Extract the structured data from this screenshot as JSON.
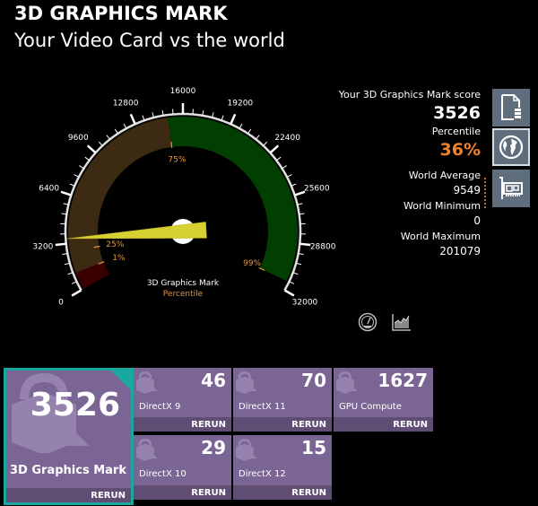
{
  "header": {
    "title": "3D GRAPHICS MARK",
    "subtitle": "Your Video Card vs the world"
  },
  "gauge": {
    "min": 0,
    "max": 32000,
    "value": 3526,
    "major_ticks": [
      "0",
      "3200",
      "6400",
      "9600",
      "12800",
      "16000",
      "19200",
      "22400",
      "25600",
      "28800",
      "32000"
    ],
    "bands": [
      {
        "name": "bottom-1-percent",
        "from": 0,
        "to": 1200,
        "color": "#3a0000"
      },
      {
        "name": "1-to-75-percent",
        "from": 1200,
        "to": 15000,
        "color": "#3c2a12"
      },
      {
        "name": "75-to-99-percent",
        "from": 15000,
        "to": 31400,
        "color": "#003f00"
      }
    ],
    "percentile_markers": [
      {
        "label": "1%",
        "value": 1200
      },
      {
        "label": "25%",
        "value": 2650
      },
      {
        "label": "75%",
        "value": 15000
      },
      {
        "label": "99%",
        "value": 31400
      }
    ],
    "center_label": "3D Graphics Mark",
    "center_sublabel": "Percentile",
    "needle_color": "#d6d030"
  },
  "stats": {
    "score_label": "Your 3D Graphics Mark score",
    "score": "3526",
    "percentile_label": "Percentile",
    "percentile": "36%",
    "world_average_label": "World Average",
    "world_average": "9549",
    "world_minimum_label": "World Minimum",
    "world_minimum": "0",
    "world_maximum_label": "World Maximum",
    "world_maximum": "201079"
  },
  "side_buttons": [
    {
      "name": "report-icon"
    },
    {
      "name": "globe-icon",
      "active": true
    },
    {
      "name": "graphics-card-icon"
    }
  ],
  "mini_icons": [
    "speedometer-icon",
    "chart-icon"
  ],
  "tiles": {
    "main": {
      "value": "3526",
      "label": "3D Graphics Mark",
      "rerun": "RERUN"
    },
    "dx9": {
      "value": "46",
      "label": "DirectX 9",
      "rerun": "RERUN"
    },
    "dx11": {
      "value": "70",
      "label": "DirectX 11",
      "rerun": "RERUN"
    },
    "gpu": {
      "value": "1627",
      "label": "GPU Compute",
      "rerun": "RERUN"
    },
    "dx10": {
      "value": "29",
      "label": "DirectX 10",
      "rerun": "RERUN"
    },
    "dx12": {
      "value": "15",
      "label": "DirectX 12",
      "rerun": "RERUN"
    }
  }
}
